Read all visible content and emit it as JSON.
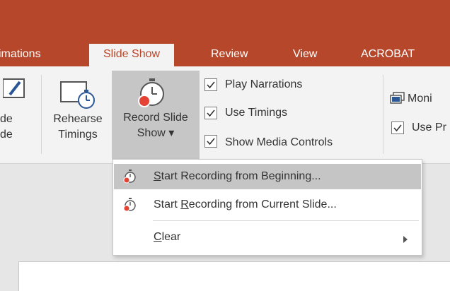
{
  "tabs": [
    {
      "label": "imations",
      "active": false
    },
    {
      "label": "Slide Show",
      "active": true
    },
    {
      "label": "Review",
      "active": false
    },
    {
      "label": "View",
      "active": false
    },
    {
      "label": "ACROBAT",
      "active": false
    }
  ],
  "ribbon": {
    "partial_button": {
      "line1": "de",
      "line2": "de"
    },
    "rehearse": {
      "line1": "Rehearse",
      "line2": "Timings"
    },
    "record": {
      "line1": "Record Slide",
      "line2": "Show ▾"
    },
    "checkboxes": [
      {
        "label": "Play Narrations",
        "checked": true
      },
      {
        "label": "Use Timings",
        "checked": true
      },
      {
        "label": "Show Media Controls",
        "checked": true
      }
    ],
    "monitor": {
      "label": "Moni"
    },
    "use_presenter": {
      "label": "Use Pr",
      "checked": true
    }
  },
  "menu": {
    "items": [
      {
        "label_pre": "",
        "accel": "S",
        "label_post": "tart Recording from Beginning...",
        "icon": "record-clock-icon",
        "highlighted": true
      },
      {
        "label_pre": "Start ",
        "accel": "R",
        "label_post": "ecording from Current Slide...",
        "icon": "record-clock-icon",
        "highlighted": false
      },
      {
        "label_pre": "",
        "accel": "C",
        "label_post": "lear",
        "icon": "",
        "has_submenu": true,
        "highlighted": false
      }
    ]
  },
  "colors": {
    "accent": "#b7472a",
    "ribbon_bg": "#f3f3f3",
    "menu_hover": "#c5c5c5",
    "record_dot": "#e34234"
  }
}
